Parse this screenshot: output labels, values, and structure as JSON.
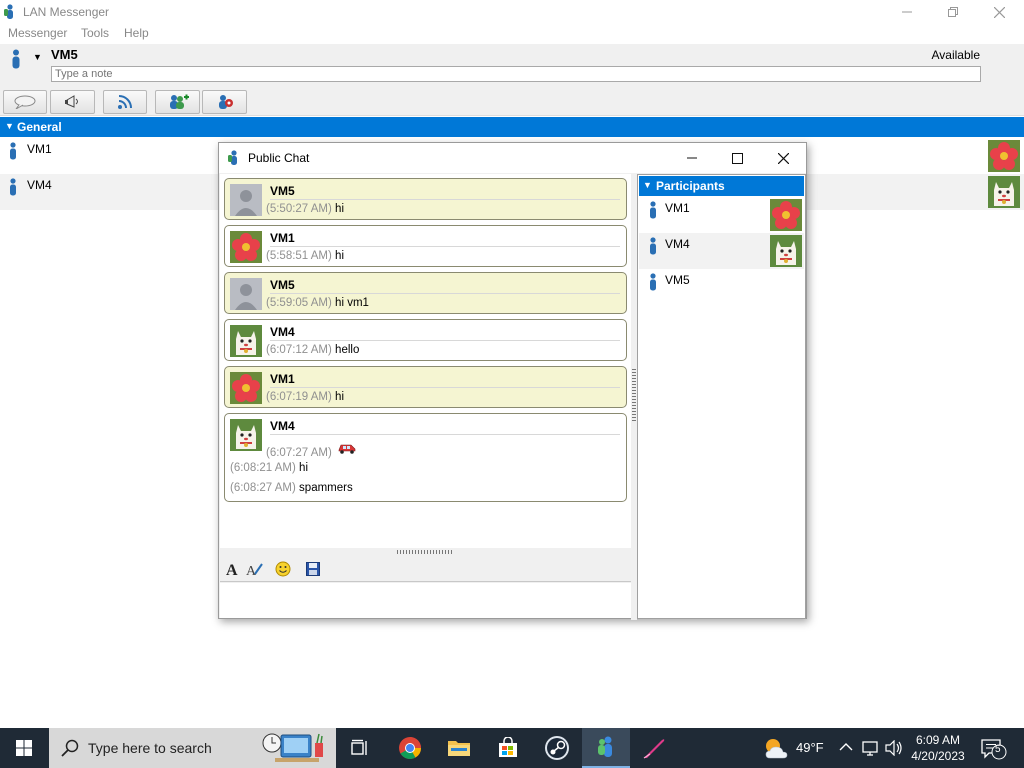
{
  "main_window": {
    "title": "LAN Messenger",
    "menu": [
      "Messenger",
      "Tools",
      "Help"
    ],
    "user_name": "VM5",
    "status": "Available",
    "note_placeholder": "Type a note",
    "group_name": "General",
    "contacts": [
      {
        "name": "VM1",
        "avatar": "flower-avatar"
      },
      {
        "name": "VM4",
        "avatar": "lucky-cat-avatar"
      }
    ]
  },
  "chat_window": {
    "title": "Public Chat",
    "messages": [
      {
        "sender": "VM5",
        "mine": true,
        "avatar": "default-avatar",
        "lines": [
          {
            "time": "(5:50:27 AM)",
            "text": "hi"
          }
        ]
      },
      {
        "sender": "VM1",
        "mine": false,
        "avatar": "flower-avatar",
        "lines": [
          {
            "time": "(5:58:51 AM)",
            "text": "hi"
          }
        ]
      },
      {
        "sender": "VM5",
        "mine": true,
        "avatar": "default-avatar",
        "lines": [
          {
            "time": "(5:59:05 AM)",
            "text": "hi vm1"
          }
        ]
      },
      {
        "sender": "VM4",
        "mine": false,
        "avatar": "lucky-cat-avatar",
        "lines": [
          {
            "time": "(6:07:12 AM)",
            "text": "hello"
          }
        ]
      },
      {
        "sender": "VM1",
        "mine": true,
        "avatar": "flower-avatar",
        "lines": [
          {
            "time": "(6:07:19 AM)",
            "text": "hi"
          }
        ]
      },
      {
        "sender": "VM4",
        "mine": false,
        "avatar": "lucky-cat-avatar",
        "lines": [
          {
            "time": "(6:07:27 AM)",
            "text": "",
            "emoticon": "car-emoticon"
          },
          {
            "time": "(6:08:21 AM)",
            "text": "hi"
          },
          {
            "time": "(6:08:27 AM)",
            "text": "spammers"
          }
        ]
      }
    ],
    "participants_header": "Participants",
    "participants": [
      {
        "name": "VM1",
        "avatar": "flower-avatar"
      },
      {
        "name": "VM4",
        "avatar": "lucky-cat-avatar"
      },
      {
        "name": "VM5",
        "avatar": ""
      }
    ]
  },
  "taskbar": {
    "search_placeholder": "Type here to search",
    "weather_temp": "49°F",
    "time": "6:09 AM",
    "date": "4/20/2023",
    "notification_count": "5"
  },
  "colors": {
    "accent": "#0078d7",
    "own_message_bg": "#f5f5d2",
    "taskbar_bg": "#1f2a36"
  }
}
